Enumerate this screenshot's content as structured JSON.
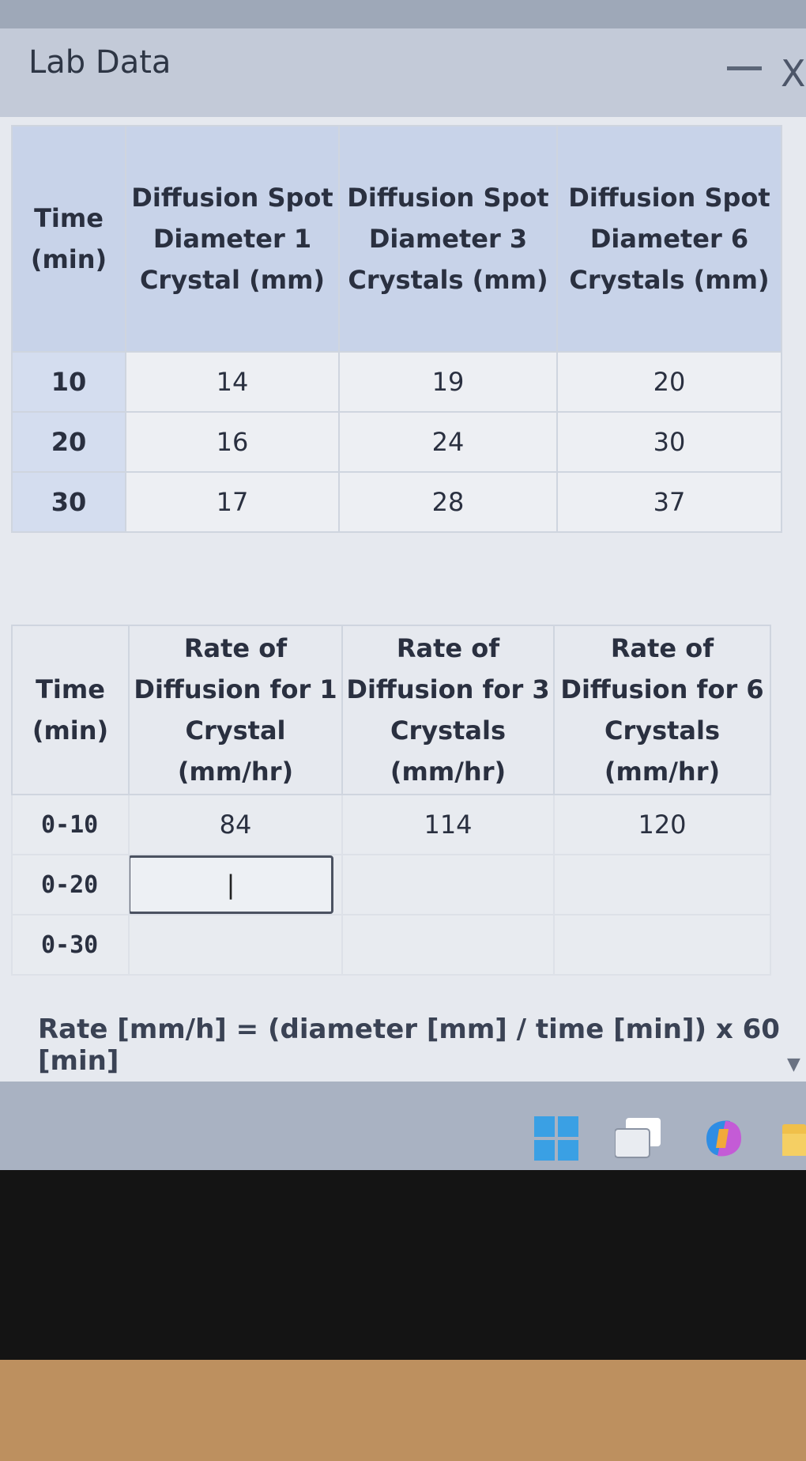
{
  "window": {
    "title": "Lab Data",
    "minimize_label": "—",
    "close_label": "X"
  },
  "table1": {
    "headers": [
      "Time (min)",
      "Diffusion Spot Diameter 1 Crystal (mm)",
      "Diffusion Spot Diameter 3 Crystals (mm)",
      "Diffusion Spot Diameter 6 Crystals (mm)"
    ],
    "rows": [
      [
        "10",
        "14",
        "19",
        "20"
      ],
      [
        "20",
        "16",
        "24",
        "30"
      ],
      [
        "30",
        "17",
        "28",
        "37"
      ]
    ]
  },
  "table2": {
    "headers": [
      "Time (min)",
      "Rate of Diffusion for 1 Crystal (mm/hr)",
      "Rate of Diffusion for 3 Crystals (mm/hr)",
      "Rate of Diffusion for 6 Crystals (mm/hr)"
    ],
    "rows": [
      [
        "0-10",
        "84",
        "114",
        "120"
      ],
      [
        "0-20",
        "",
        "",
        ""
      ],
      [
        "0-30",
        "",
        "",
        ""
      ]
    ],
    "active_input_value": "|"
  },
  "formula": "Rate [mm/h] = (diameter [mm] / time [min]) x 60 [min]",
  "taskbar": {
    "icons": [
      "windows-start-icon",
      "task-view-icon",
      "copilot-icon",
      "file-explorer-icon"
    ]
  },
  "colors": {
    "header_blue": "#c8d3e9",
    "time_cell_blue": "#d4ddef",
    "taskbar": "#a9b2c2"
  }
}
